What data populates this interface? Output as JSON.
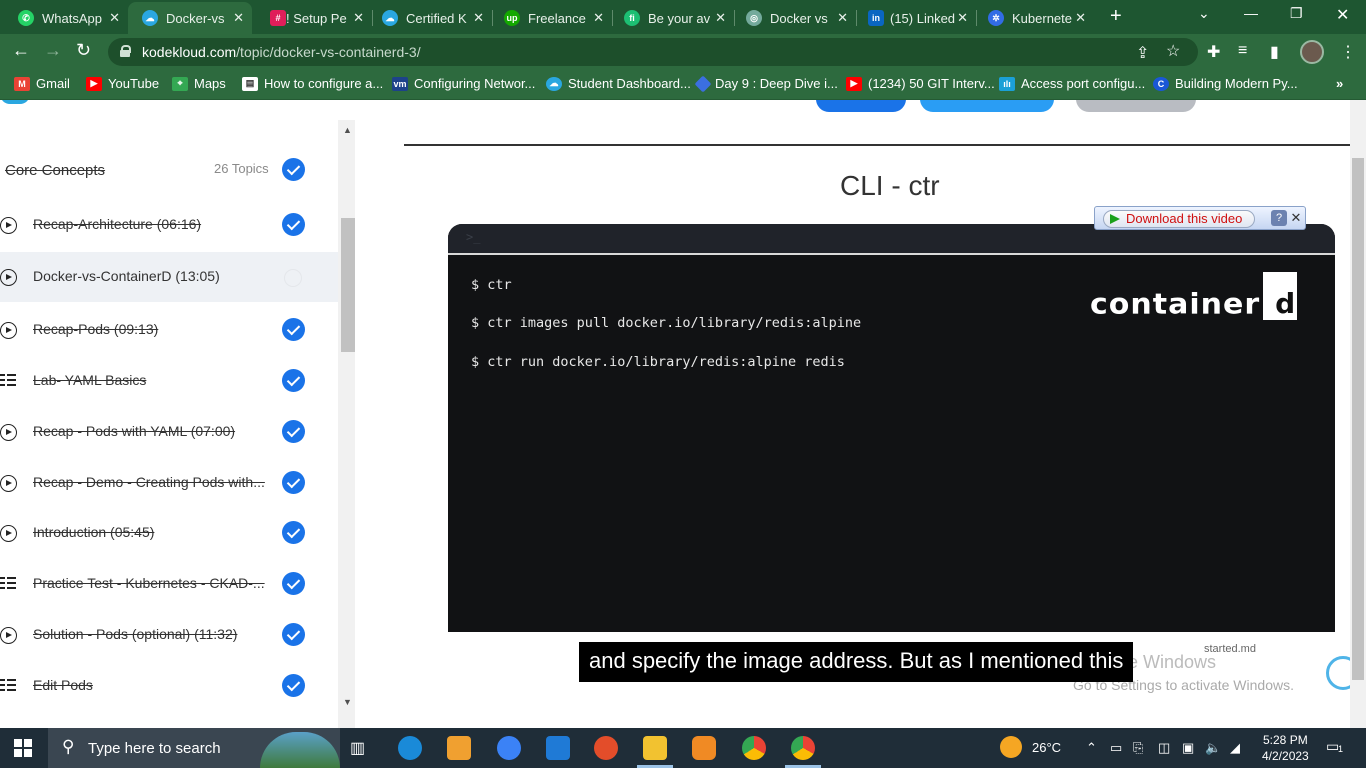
{
  "browser": {
    "tabs": [
      {
        "label": "WhatsApp",
        "icon": "whatsapp-icon",
        "color": "#25d366"
      },
      {
        "label": "Docker-vs",
        "icon": "kodekloud-icon",
        "color": "#2aa7e0"
      },
      {
        "label": "! Setup Pe",
        "icon": "slack-icon",
        "color": "#e01e5a"
      },
      {
        "label": "Certified K",
        "icon": "kodekloud-icon",
        "color": "#2aa7e0"
      },
      {
        "label": "Freelance",
        "icon": "upwork-icon",
        "color": "#14a800"
      },
      {
        "label": "Be your av",
        "icon": "fiverr-icon",
        "color": "#1dbf73"
      },
      {
        "label": "Docker vs",
        "icon": "openai-icon",
        "color": "#74aa9c"
      },
      {
        "label": "(15) Linked",
        "icon": "linkedin-icon",
        "color": "#0a66c2"
      },
      {
        "label": "Kubernete",
        "icon": "kubernetes-icon",
        "color": "#326ce5"
      }
    ],
    "url_domain": "kodekloud.com",
    "url_path": "/topic/docker-vs-containerd-3/",
    "bookmarks": [
      {
        "label": "Gmail",
        "icon": "gmail-icon",
        "color": "#ea4335"
      },
      {
        "label": "YouTube",
        "icon": "youtube-icon",
        "color": "#ff0000"
      },
      {
        "label": "Maps",
        "icon": "maps-icon",
        "color": "#34a853"
      },
      {
        "label": "How to configure a...",
        "icon": "page-icon",
        "color": "#ffffff"
      },
      {
        "label": "Configuring Networ...",
        "icon": "vmware-icon",
        "color": "#1d428a"
      },
      {
        "label": "Student Dashboard...",
        "icon": "kodekloud-icon",
        "color": "#2aa7e0"
      },
      {
        "label": "Day 9 : Deep Dive i...",
        "icon": "diamond-icon",
        "color": "#3b6fe0"
      },
      {
        "label": "(1234) 50 GIT Interv...",
        "icon": "youtube-icon",
        "color": "#ff0000"
      },
      {
        "label": "Access port configu...",
        "icon": "cisco-icon",
        "color": "#1ba0d7"
      },
      {
        "label": "Building Modern Py...",
        "icon": "c-icon",
        "color": "#1a57d6"
      }
    ]
  },
  "sidebar": {
    "section_title": "Core Concepts",
    "section_count": "26 Topics",
    "lessons": [
      {
        "title": "Recap-Architecture (06:16)",
        "type": "video",
        "completed": true
      },
      {
        "title": "Docker-vs-ContainerD (13:05)",
        "type": "video",
        "completed": false
      },
      {
        "title": "Recap-Pods (09:13)",
        "type": "video",
        "completed": true
      },
      {
        "title": "Lab- YAML Basics",
        "type": "lab",
        "completed": true
      },
      {
        "title": "Recap - Pods with YAML (07:00)",
        "type": "video",
        "completed": true
      },
      {
        "title": "Recap - Demo - Creating Pods with...",
        "type": "video",
        "completed": true
      },
      {
        "title": "Introduction (05:45)",
        "type": "video",
        "completed": true
      },
      {
        "title": "Practice Test - Kubernetes - CKAD-...",
        "type": "lab",
        "completed": true
      },
      {
        "title": "Solution - Pods (optional) (11:32)",
        "type": "video",
        "completed": true
      },
      {
        "title": "Edit Pods",
        "type": "lab",
        "completed": true
      }
    ]
  },
  "slide": {
    "title": "CLI - ctr",
    "terminal_icon": ">_",
    "commands": [
      "$ ctr",
      "$ ctr images pull docker.io/library/redis:alpine",
      "$ ctr run docker.io/library/redis:alpine redis"
    ],
    "logo_text": "container",
    "logo_box": "d"
  },
  "video": {
    "download_label": "Download this video",
    "help_label": "?",
    "close_label": "✕",
    "caption": "and specify the image address. But as I mentioned this",
    "file_hint": "started.md"
  },
  "windows": {
    "activate_title": "Activate Windows",
    "activate_hint": "Go to Settings to activate Windows.",
    "search_placeholder": "Type here to search",
    "weather": "26°C",
    "time": "5:28 PM",
    "date": "4/2/2023",
    "notifications": "1"
  }
}
